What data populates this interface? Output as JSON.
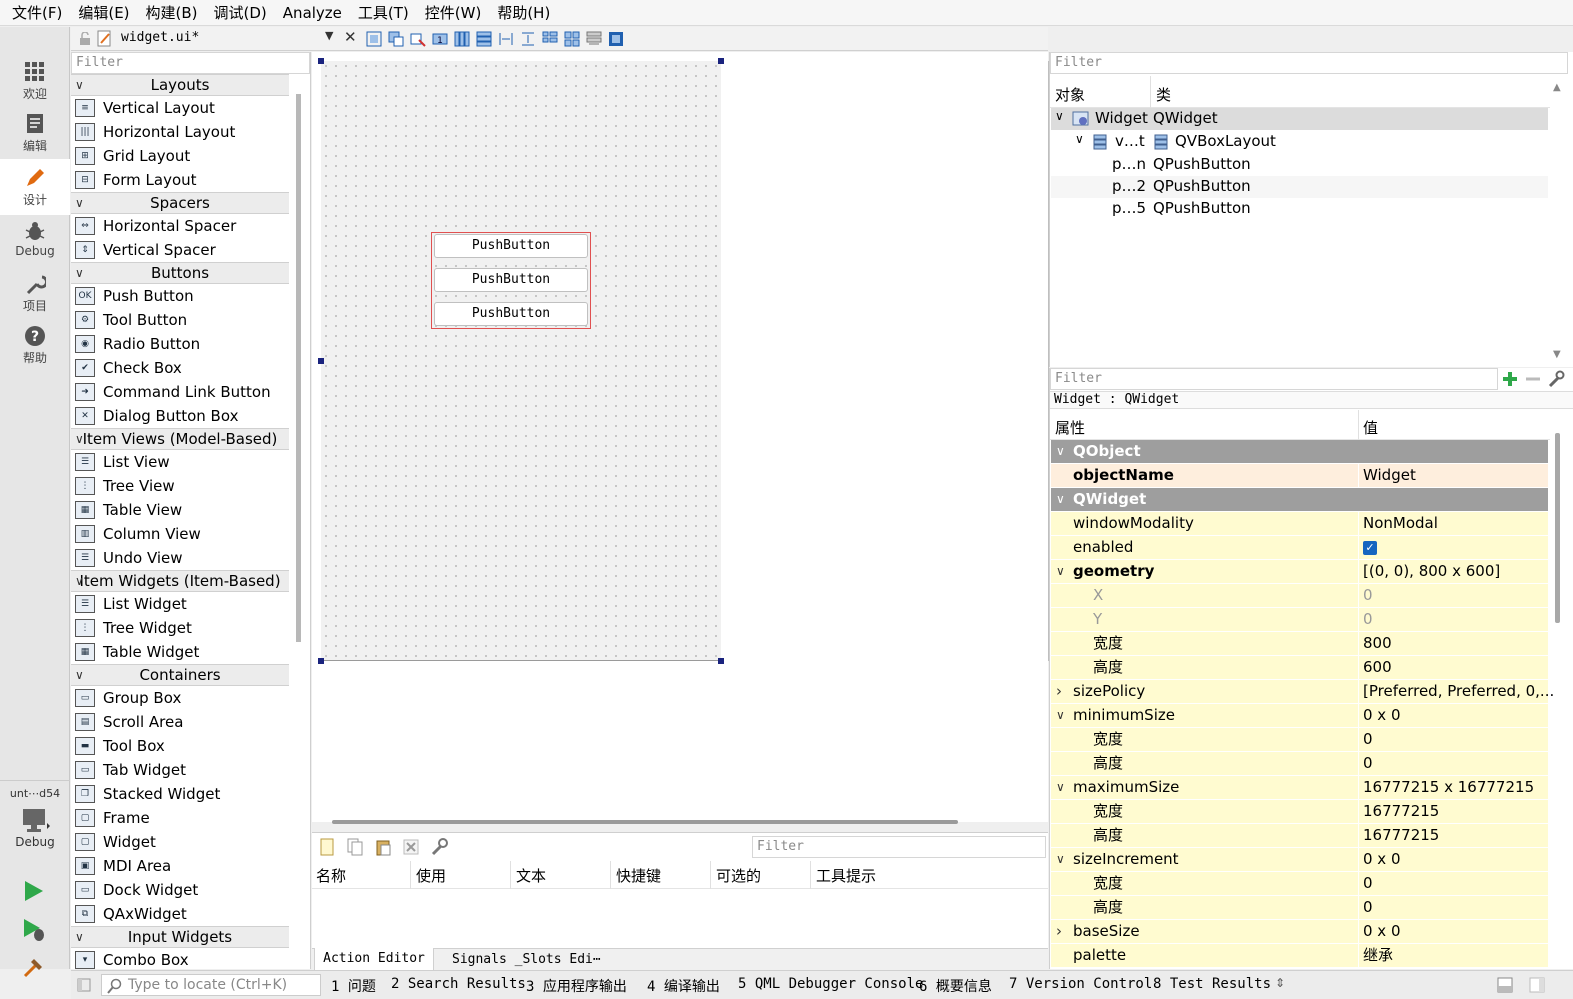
{
  "menubar": [
    "文件(F)",
    "编辑(E)",
    "构建(B)",
    "调试(D)",
    "Analyze",
    "工具(T)",
    "控件(W)",
    "帮助(H)"
  ],
  "modes": {
    "welcome": "欢迎",
    "edit": "编辑",
    "design": "设计",
    "debug": "Debug",
    "projects": "项目",
    "help": "帮助"
  },
  "kit": {
    "name": "unt⋯d54",
    "label": "Debug"
  },
  "doc": {
    "filename": "widget.ui*"
  },
  "widgetbox": {
    "filter_placeholder": "Filter",
    "categories": [
      {
        "title": "Layouts",
        "items": [
          "Vertical Layout",
          "Horizontal Layout",
          "Grid Layout",
          "Form Layout"
        ]
      },
      {
        "title": "Spacers",
        "items": [
          "Horizontal Spacer",
          "Vertical Spacer"
        ]
      },
      {
        "title": "Buttons",
        "items": [
          "Push Button",
          "Tool Button",
          "Radio Button",
          "Check Box",
          "Command Link Button",
          "Dialog Button Box"
        ]
      },
      {
        "title": "Item Views (Model-Based)",
        "items": [
          "List View",
          "Tree View",
          "Table View",
          "Column View",
          "Undo View"
        ]
      },
      {
        "title": "Item Widgets (Item-Based)",
        "items": [
          "List Widget",
          "Tree Widget",
          "Table Widget"
        ]
      },
      {
        "title": "Containers",
        "items": [
          "Group Box",
          "Scroll Area",
          "Tool Box",
          "Tab Widget",
          "Stacked Widget",
          "Frame",
          "Widget",
          "MDI Area",
          "Dock Widget",
          "QAxWidget"
        ]
      },
      {
        "title": "Input Widgets",
        "items": [
          "Combo Box"
        ]
      }
    ]
  },
  "form": {
    "buttons": [
      "PushButton",
      "PushButton",
      "PushButton"
    ]
  },
  "action_editor": {
    "filter_placeholder": "Filter",
    "columns": [
      "名称",
      "使用",
      "文本",
      "快捷键",
      "可选的",
      "工具提示"
    ],
    "tabs": [
      "Action Editor",
      "Signals _Slots Edi⋯"
    ]
  },
  "object_inspector": {
    "filter_placeholder": "Filter",
    "columns": [
      "对象",
      "类"
    ],
    "rows": [
      {
        "obj": "Widget",
        "cls": "QWidget"
      },
      {
        "obj": "v…t",
        "cls": "QVBoxLayout"
      },
      {
        "obj": "p…n",
        "cls": "QPushButton"
      },
      {
        "obj": "p…2",
        "cls": "QPushButton"
      },
      {
        "obj": "p…5",
        "cls": "QPushButton"
      }
    ]
  },
  "property_editor": {
    "filter_placeholder": "Filter",
    "context": "Widget : QWidget",
    "columns": [
      "属性",
      "值"
    ],
    "rows": [
      {
        "name": "QObject",
        "value": "",
        "kind": "group"
      },
      {
        "name": "objectName",
        "value": "Widget",
        "kind": "bold"
      },
      {
        "name": "QWidget",
        "value": "",
        "kind": "group"
      },
      {
        "name": "windowModality",
        "value": "NonModal",
        "kind": "normal"
      },
      {
        "name": "enabled",
        "value": "",
        "kind": "check"
      },
      {
        "name": "geometry",
        "value": "[(0, 0), 800 x 600]",
        "kind": "boldexp"
      },
      {
        "name": "X",
        "value": "0",
        "kind": "subdim"
      },
      {
        "name": "Y",
        "value": "0",
        "kind": "subdim"
      },
      {
        "name": "宽度",
        "value": "800",
        "kind": "sub"
      },
      {
        "name": "高度",
        "value": "600",
        "kind": "sub"
      },
      {
        "name": "sizePolicy",
        "value": "[Preferred, Preferred, 0,...",
        "kind": "collapsed"
      },
      {
        "name": "minimumSize",
        "value": "0 x 0",
        "kind": "expanded"
      },
      {
        "name": "宽度",
        "value": "0",
        "kind": "sub"
      },
      {
        "name": "高度",
        "value": "0",
        "kind": "sub"
      },
      {
        "name": "maximumSize",
        "value": "16777215 x 16777215",
        "kind": "expanded"
      },
      {
        "name": "宽度",
        "value": "16777215",
        "kind": "sub"
      },
      {
        "name": "高度",
        "value": "16777215",
        "kind": "sub"
      },
      {
        "name": "sizeIncrement",
        "value": "0 x 0",
        "kind": "expanded"
      },
      {
        "name": "宽度",
        "value": "0",
        "kind": "sub"
      },
      {
        "name": "高度",
        "value": "0",
        "kind": "sub"
      },
      {
        "name": "baseSize",
        "value": "0 x 0",
        "kind": "collapsed"
      },
      {
        "name": "palette",
        "value": "继承",
        "kind": "normal"
      }
    ]
  },
  "statusbar": {
    "locate_placeholder": "Type to locate (Ctrl+K)",
    "panes": [
      "1 问题",
      "2 Search Results",
      "3 应用程序输出",
      "4 编译输出",
      "5 QML Debugger Console",
      "6 概要信息",
      "7 Version Control",
      "8 Test Results"
    ]
  },
  "colors": {
    "accent": "#1565c0",
    "group_bg": "#9e9e9e",
    "row_yellow": "#fffbd0",
    "row_orange": "#feeedd",
    "selection_red": "#e05050"
  }
}
